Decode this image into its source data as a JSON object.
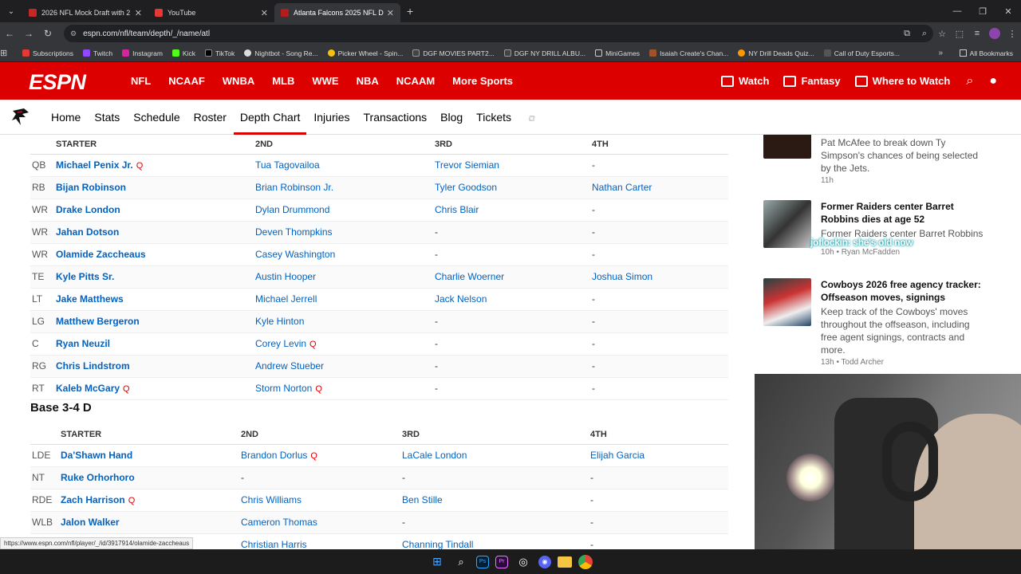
{
  "browser": {
    "tabs": [
      {
        "title": "2026 NFL Mock Draft with 2 Ro",
        "active": false,
        "color": "#c62828"
      },
      {
        "title": "YouTube",
        "active": false,
        "color": "#e53935"
      },
      {
        "title": "Atlanta Falcons 2025 NFL Depth",
        "active": true,
        "color": "#b71c1c"
      }
    ],
    "url": "espn.com/nfl/team/depth/_/name/atl",
    "bookmarks": [
      "Subscriptions",
      "Twitch",
      "Instagram",
      "Kick",
      "TikTok",
      "Nightbot - Song Re...",
      "Picker Wheel - Spin...",
      "DGF MOVIES PART2...",
      "DGF NY DRILL ALBU...",
      "MiniGames",
      "Isaiah Create's Chan...",
      "NY Drill Deads Quiz...",
      "Call of Duty Esports..."
    ],
    "all_bookmarks": "All Bookmarks",
    "status_url": "https://www.espn.com/nfl/player/_/id/3917914/olamide-zaccheaus"
  },
  "espn": {
    "logo": "ESPN",
    "links": [
      "NFL",
      "NCAAF",
      "WNBA",
      "MLB",
      "WWE",
      "NBA",
      "NCAAM",
      "More Sports"
    ],
    "right": {
      "watch": "Watch",
      "fantasy": "Fantasy",
      "where": "Where to Watch"
    }
  },
  "subnav": {
    "links": [
      "Home",
      "Stats",
      "Schedule",
      "Roster",
      "Depth Chart",
      "Injuries",
      "Transactions",
      "Blog",
      "Tickets"
    ],
    "active": "Depth Chart"
  },
  "offense": {
    "headers": [
      "STARTER",
      "2ND",
      "3RD",
      "4TH"
    ],
    "rows": [
      {
        "pos": "QB",
        "p": [
          "Michael Penix Jr.",
          "Tua Tagovailoa",
          "Trevor Siemian",
          "-"
        ],
        "q": [
          true,
          false,
          false,
          false
        ]
      },
      {
        "pos": "RB",
        "p": [
          "Bijan Robinson",
          "Brian Robinson Jr.",
          "Tyler Goodson",
          "Nathan Carter"
        ],
        "q": [
          false,
          false,
          false,
          false
        ]
      },
      {
        "pos": "WR",
        "p": [
          "Drake London",
          "Dylan Drummond",
          "Chris Blair",
          "-"
        ],
        "q": [
          false,
          false,
          false,
          false
        ]
      },
      {
        "pos": "WR",
        "p": [
          "Jahan Dotson",
          "Deven Thompkins",
          "-",
          "-"
        ],
        "q": [
          false,
          false,
          false,
          false
        ]
      },
      {
        "pos": "WR",
        "p": [
          "Olamide Zaccheaus",
          "Casey Washington",
          "-",
          "-"
        ],
        "q": [
          false,
          false,
          false,
          false
        ]
      },
      {
        "pos": "TE",
        "p": [
          "Kyle Pitts Sr.",
          "Austin Hooper",
          "Charlie Woerner",
          "Joshua Simon"
        ],
        "q": [
          false,
          false,
          false,
          false
        ]
      },
      {
        "pos": "LT",
        "p": [
          "Jake Matthews",
          "Michael Jerrell",
          "Jack Nelson",
          "-"
        ],
        "q": [
          false,
          false,
          false,
          false
        ]
      },
      {
        "pos": "LG",
        "p": [
          "Matthew Bergeron",
          "Kyle Hinton",
          "-",
          "-"
        ],
        "q": [
          false,
          false,
          false,
          false
        ]
      },
      {
        "pos": "C",
        "p": [
          "Ryan Neuzil",
          "Corey Levin",
          "-",
          "-"
        ],
        "q": [
          false,
          true,
          false,
          false
        ]
      },
      {
        "pos": "RG",
        "p": [
          "Chris Lindstrom",
          "Andrew Stueber",
          "-",
          "-"
        ],
        "q": [
          false,
          false,
          false,
          false
        ]
      },
      {
        "pos": "RT",
        "p": [
          "Kaleb McGary",
          "Storm Norton",
          "-",
          "-"
        ],
        "q": [
          true,
          true,
          false,
          false
        ]
      }
    ]
  },
  "defense": {
    "title": "Base 3-4 D",
    "headers": [
      "STARTER",
      "2ND",
      "3RD",
      "4TH"
    ],
    "rows": [
      {
        "pos": "LDE",
        "p": [
          "Da'Shawn Hand",
          "Brandon Dorlus",
          "LaCale London",
          "Elijah Garcia"
        ],
        "q": [
          false,
          true,
          false,
          false
        ]
      },
      {
        "pos": "NT",
        "p": [
          "Ruke Orhorhoro",
          "-",
          "-",
          "-"
        ],
        "q": [
          false,
          false,
          false,
          false
        ]
      },
      {
        "pos": "RDE",
        "p": [
          "Zach Harrison",
          "Chris Williams",
          "Ben Stille",
          "-"
        ],
        "q": [
          true,
          false,
          false,
          false
        ]
      },
      {
        "pos": "WLB",
        "p": [
          "Jalon Walker",
          "Cameron Thomas",
          "-",
          "-"
        ],
        "q": [
          false,
          false,
          false,
          false
        ]
      },
      {
        "pos": "",
        "p": [
          "",
          "Christian Harris",
          "Channing Tindall",
          "-"
        ],
        "q": [
          false,
          false,
          false,
          false
        ]
      }
    ]
  },
  "q_label": "Q",
  "sidebar": {
    "stories": [
      {
        "title": "",
        "desc": "Pat McAfee to break down Ty Simpson's chances of being selected by the Jets.",
        "meta": "11h"
      },
      {
        "title": "Former Raiders center Barret Robbins dies at age 52",
        "desc": "Former Raiders center Barret Robbins",
        "meta": "10h • Ryan McFadden"
      },
      {
        "title": "Cowboys 2026 free agency tracker: Offseason moves, signings",
        "desc": "Keep track of the Cowboys' moves throughout the offseason, including free agent signings, contracts and more.",
        "meta": "13h • Todd Archer"
      }
    ],
    "overlay": "joflockin: she's old now"
  }
}
